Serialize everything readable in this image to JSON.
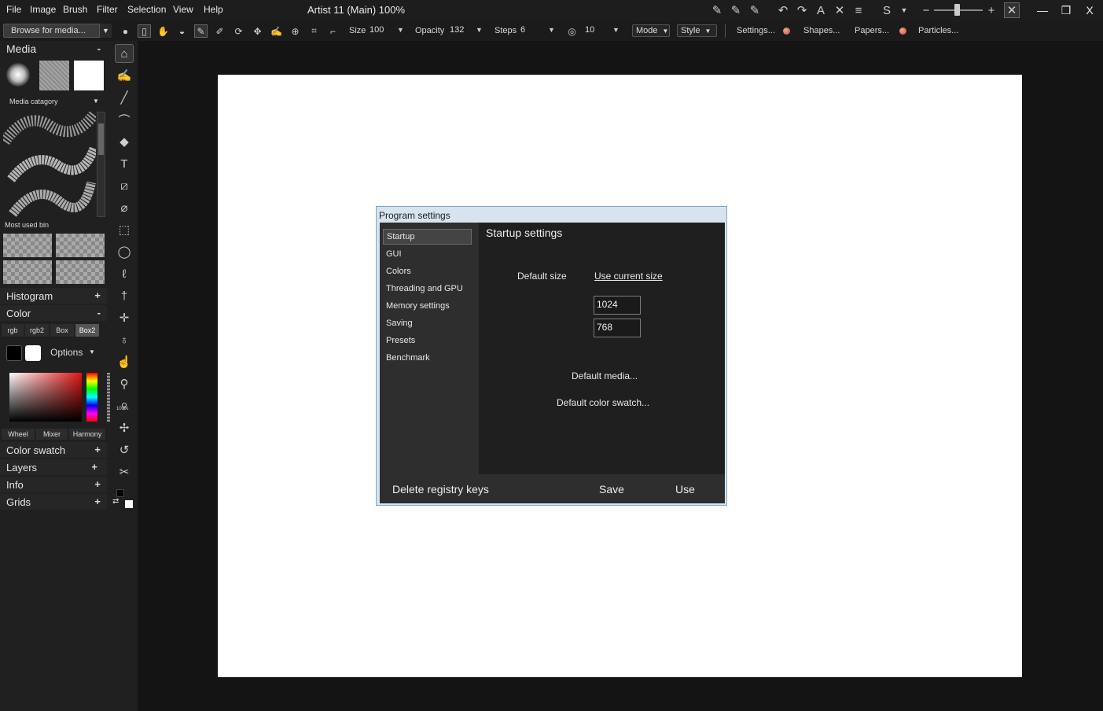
{
  "menu": {
    "file": "File",
    "image": "Image",
    "brush": "Brush",
    "filter": "Filter",
    "selection": "Selection",
    "view": "View",
    "help": "Help"
  },
  "app_title": "Artist 11 (Main)  100%",
  "toolbar": {
    "browse_label": "Browse for media...",
    "size_label": "Size",
    "size_value": "100",
    "opacity_label": "Opacity",
    "opacity_value": "132",
    "steps_label": "Steps",
    "steps_value": "6",
    "smoothing_value": "10",
    "mode_label": "Mode",
    "style_label": "Style",
    "settings_label": "Settings...",
    "shapes_label": "Shapes...",
    "papers_label": "Papers...",
    "particles_label": "Particles..."
  },
  "left_panel": {
    "media_title": "Media",
    "media_sign": "-",
    "media_category": "Media catagory",
    "most_used_bin": "Most used bin",
    "histogram_title": "Histogram",
    "histogram_sign": "+",
    "color_title": "Color",
    "color_sign": "-",
    "color_tabs": [
      "rgb",
      "rgb2",
      "Box",
      "Box2"
    ],
    "options_label": "Options",
    "percent_label": "100%",
    "bottom_tabs": [
      "Wheel",
      "Mixer",
      "Harmony"
    ],
    "color_swatch_title": "Color swatch",
    "color_swatch_sign": "+",
    "layers_title": "Layers",
    "layers_sign": "+",
    "info_title": "Info",
    "info_sign": "+",
    "grids_title": "Grids",
    "grids_sign": "+"
  },
  "dialog": {
    "title": "Program settings",
    "nav": [
      "Startup",
      "GUI",
      "Colors",
      "Threading and GPU",
      "Memory settings",
      "Saving",
      "Presets",
      "Benchmark"
    ],
    "heading": "Startup settings",
    "default_size_label": "Default size",
    "use_current_size": "Use current size",
    "width_value": "1024",
    "height_value": "768",
    "default_media": "Default media...",
    "default_color_swatch": "Default color swatch...",
    "delete_registry": "Delete registry keys",
    "save": "Save",
    "use": "Use"
  },
  "colors": {
    "accent_active_tab": "#555555",
    "dialog_frame": "#d7e4f0"
  }
}
